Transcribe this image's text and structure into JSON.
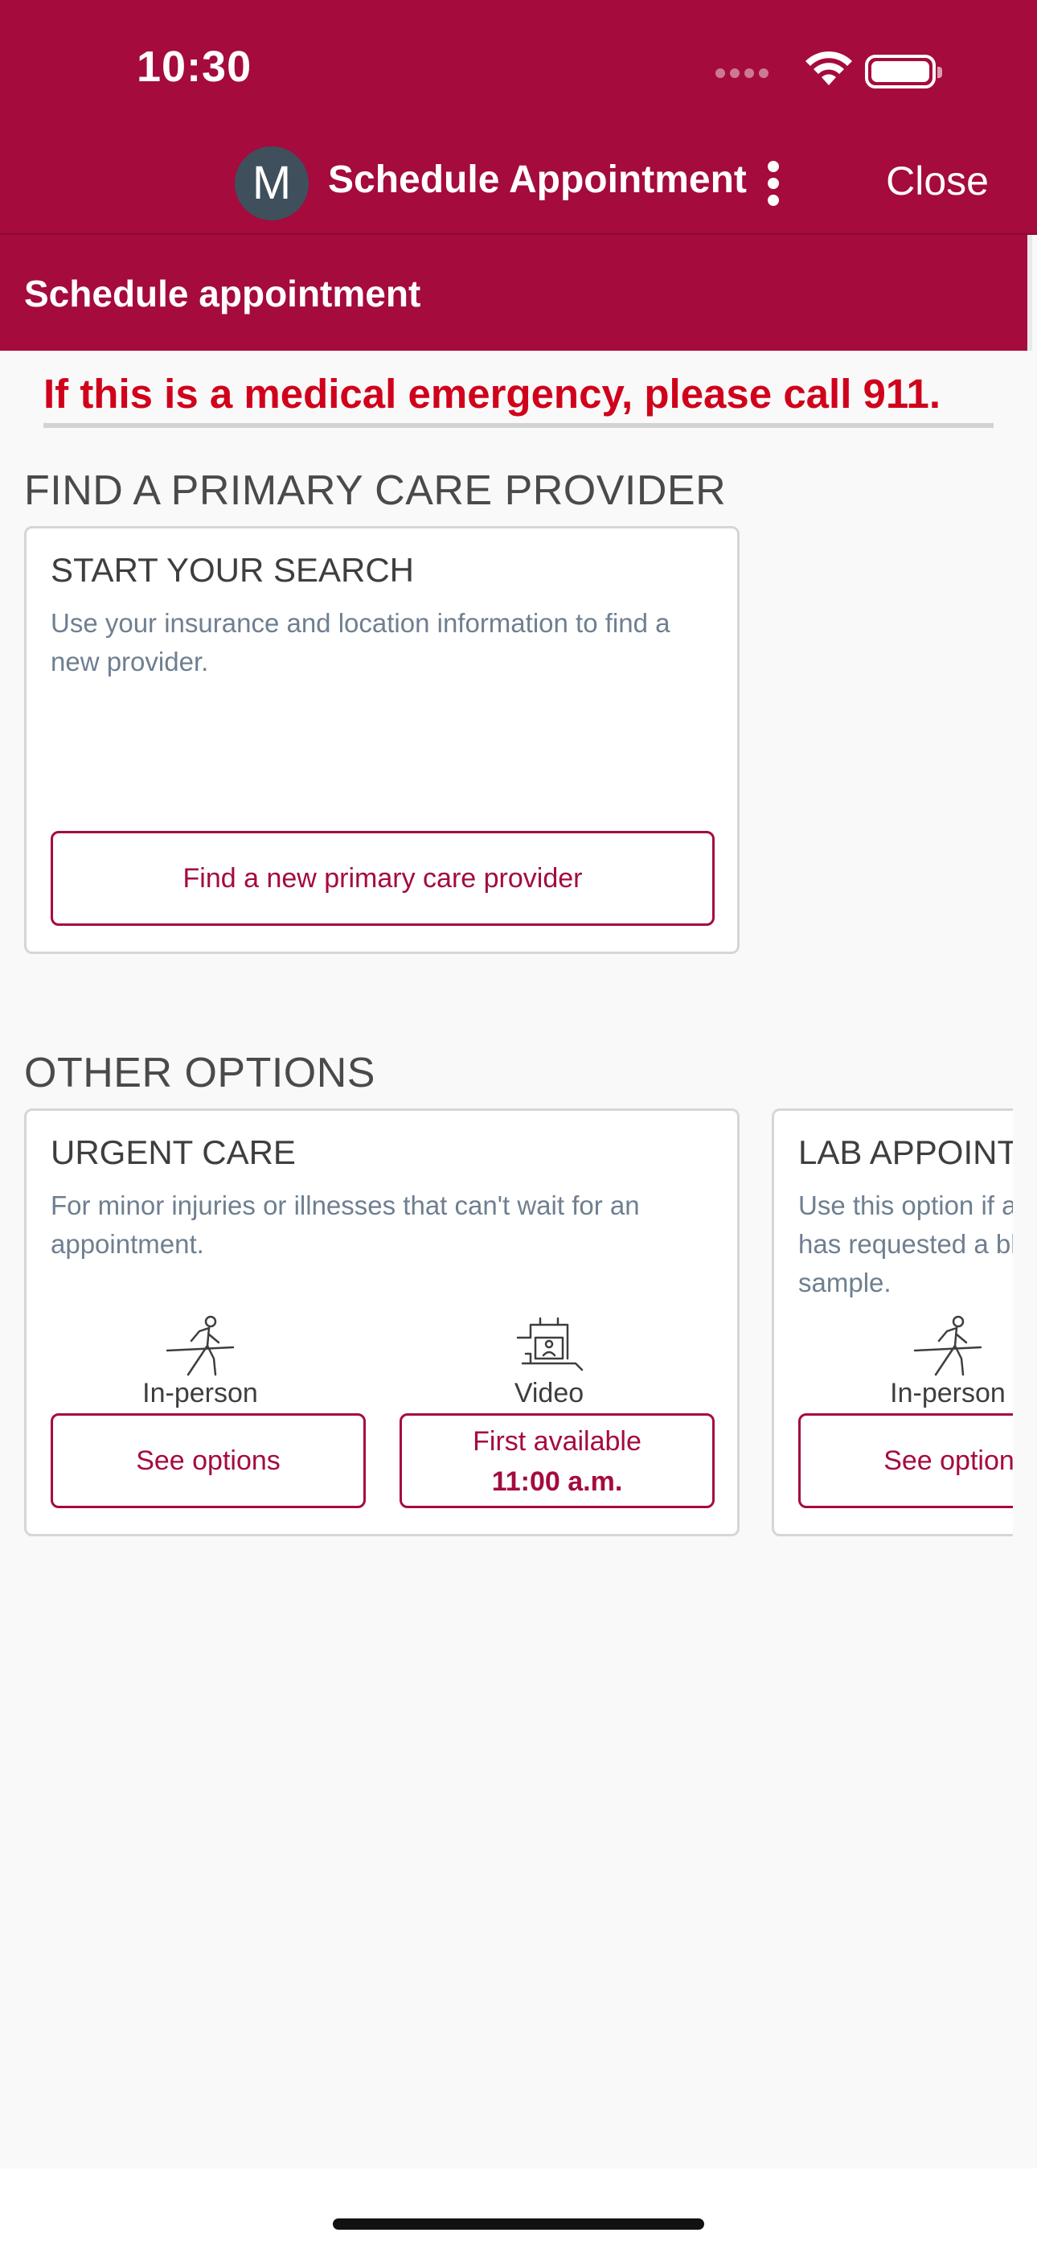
{
  "status_bar": {
    "time": "10:30"
  },
  "nav": {
    "avatar_initial": "M",
    "title": "Schedule Appointment",
    "close_label": "Close"
  },
  "page_header": {
    "title": "Schedule appointment"
  },
  "emergency": {
    "text": "If this is a medical emergency, please call 911."
  },
  "primary_care": {
    "section_title": "FIND A PRIMARY CARE PROVIDER",
    "card": {
      "title": "START YOUR SEARCH",
      "description": "Use your insurance and location information to find a new provider.",
      "button_label": "Find a new primary care provider"
    }
  },
  "other_options": {
    "section_title": "OTHER OPTIONS",
    "cards": [
      {
        "title": "URGENT CARE",
        "description": "For minor injuries or illnesses that can't wait for an appointment.",
        "modes": [
          {
            "label": "In-person",
            "icon": "walking-person-icon",
            "button_label": "See options"
          },
          {
            "label": "Video",
            "icon": "video-visit-icon",
            "button_line1": "First available",
            "button_line2": "11:00 a.m."
          }
        ]
      },
      {
        "title": "LAB APPOINTMENT",
        "description": "Use this option if a UCHealth clinic has requested a blood draw or urine sample.",
        "modes": [
          {
            "label": "In-person",
            "icon": "walking-person-icon",
            "button_label": "See options"
          }
        ]
      }
    ]
  },
  "colors": {
    "brand": "#a50b3d",
    "emergency_text": "#d0021b",
    "description_text": "#6e7f90",
    "avatar_bg": "#3f4f5c"
  }
}
